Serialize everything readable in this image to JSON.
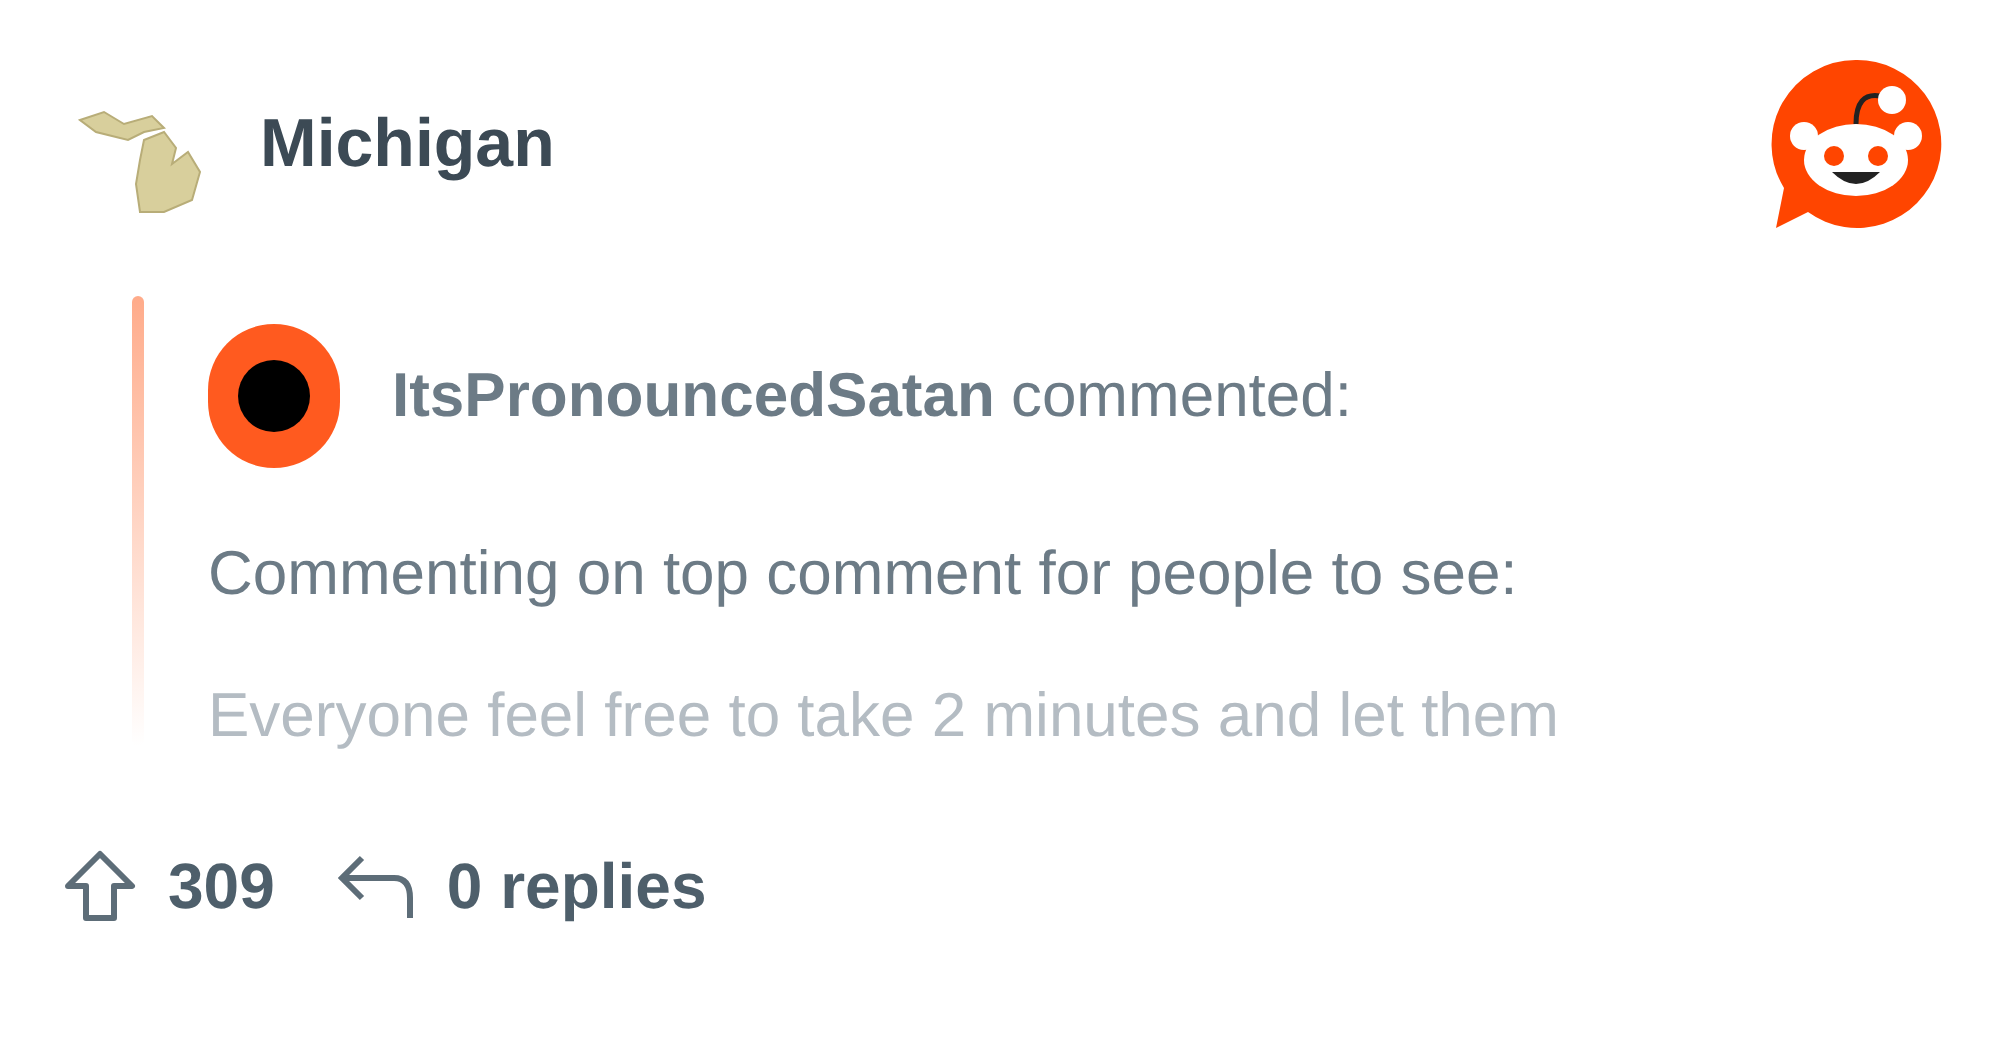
{
  "header": {
    "title": "Michigan"
  },
  "comment": {
    "username": "ItsPronouncedSatan",
    "action": "commented:",
    "lines": [
      "Commenting on top comment for people to see:",
      "Everyone feel free to take 2 minutes and let them"
    ]
  },
  "footer": {
    "upvotes": "309",
    "replies": "0 replies"
  }
}
